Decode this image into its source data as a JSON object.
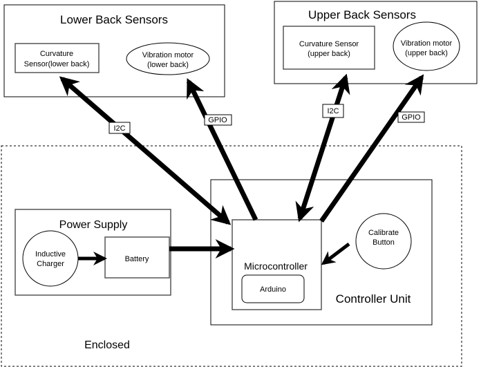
{
  "lower_back": {
    "title": "Lower Back Sensors",
    "curvature": [
      "Curvature",
      "Sensor(lower back)"
    ],
    "vibration": [
      "Vibration motor",
      "(lower back)"
    ]
  },
  "upper_back": {
    "title": "Upper Back Sensors",
    "curvature": [
      "Curvature Sensor",
      "(upper back)"
    ],
    "vibration": [
      "Vibration motor",
      "(upper back)"
    ]
  },
  "enclosure": {
    "label": "Enclosed"
  },
  "power_supply": {
    "title": "Power Supply",
    "charger": [
      "Inductive",
      "Charger"
    ],
    "battery": "Battery"
  },
  "controller": {
    "title": "Controller Unit",
    "microcontroller": "Microcontroller",
    "arduino": "Arduino",
    "calibrate": [
      "Calibrate",
      "Button"
    ]
  },
  "links": {
    "lower_i2c": "I2C",
    "lower_gpio": "GPIO",
    "upper_i2c": "I2C",
    "upper_gpio": "GPIO"
  }
}
